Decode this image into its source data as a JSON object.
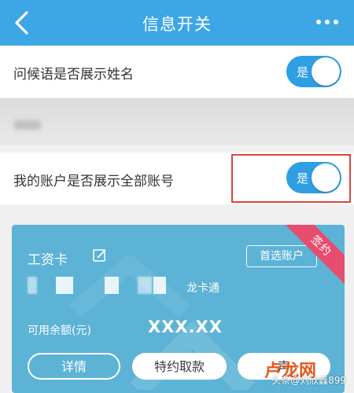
{
  "header": {
    "title": "信息开关",
    "back_icon": "chevron-left-icon",
    "more_icon": "more-dots-icon",
    "bg_color": "#3da7e6"
  },
  "settings": [
    {
      "label": "问候语是否展示姓名",
      "toggle_text": "是",
      "on": true
    },
    {
      "label": "我的账户是否展示全部账号",
      "toggle_text": "是",
      "on": true
    }
  ],
  "card": {
    "title": "工资卡",
    "preferred_label": "首选账户",
    "ribbon_label": "签约",
    "brand": "龙卡通",
    "balance_label": "可用余额(元)",
    "balance_value": "XXX.XX",
    "buttons": {
      "details": "详情",
      "cancel_agreement": "特约取款",
      "third": "声"
    },
    "bg_color": "#5cb3d6",
    "ribbon_color": "#e64d6f"
  },
  "watermark": {
    "logo_text": "卢龙网",
    "author": "头条@刘欣鑫899"
  }
}
